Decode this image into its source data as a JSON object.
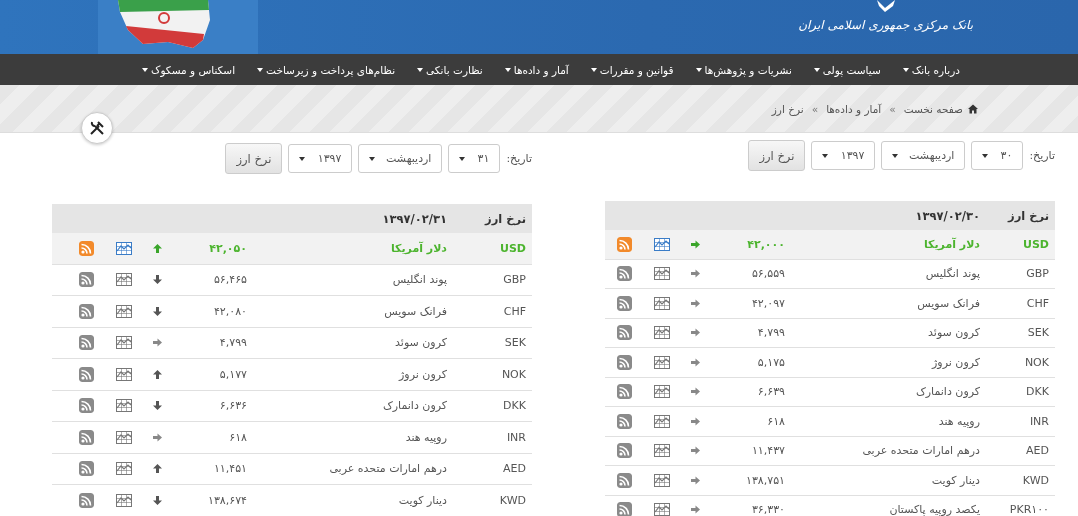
{
  "header": {
    "bank_name": "بانک مرکزی جمهوری اسلامی ایران"
  },
  "nav": [
    {
      "label": "درباره بانک"
    },
    {
      "label": "سیاست پولی"
    },
    {
      "label": "نشریات و پژوهش‌ها"
    },
    {
      "label": "قوانین و مقررات"
    },
    {
      "label": "آمار و داده‌ها"
    },
    {
      "label": "نظارت بانکی"
    },
    {
      "label": "نظام‌های پرداخت و زیرساخت"
    },
    {
      "label": "اسکناس و مسکوک"
    }
  ],
  "breadcrumb": [
    {
      "kind": "home",
      "label": "صفحه نخست"
    },
    {
      "kind": "separator",
      "label": "»"
    },
    {
      "kind": "link",
      "label": "آمار و داده‌ها"
    },
    {
      "kind": "separator",
      "label": "»"
    },
    {
      "kind": "current",
      "label": "نرخ ارز"
    }
  ],
  "panels": [
    {
      "date_label": "تاریخ:",
      "day": "۳۰",
      "month": "اردیبهشت",
      "year": "۱۳۹۷",
      "button": "نرخ ارز",
      "table": {
        "heading": "نرخ ارز",
        "date": "۱۳۹۷/۰۲/۳۰",
        "rows": [
          {
            "code": "USD",
            "name": "دلار آمریکا",
            "rate": "۴۲,۰۰۰",
            "rising": false,
            "falling": false,
            "highlighted": true
          },
          {
            "code": "GBP",
            "name": "پوند انگلیس",
            "rate": "۵۶,۵۵۹",
            "rising": false,
            "falling": false,
            "highlighted": false
          },
          {
            "code": "CHF",
            "name": "فرانک سویس",
            "rate": "۴۲,۰۹۷",
            "rising": false,
            "falling": false,
            "highlighted": false
          },
          {
            "code": "SEK",
            "name": "کرون سوئد",
            "rate": "۴,۷۹۹",
            "rising": false,
            "falling": false,
            "highlighted": false
          },
          {
            "code": "NOK",
            "name": "کرون نروژ",
            "rate": "۵,۱۷۵",
            "rising": false,
            "falling": false,
            "highlighted": false
          },
          {
            "code": "DKK",
            "name": "کرون دانمارک",
            "rate": "۶,۶۳۹",
            "rising": false,
            "falling": false,
            "highlighted": false
          },
          {
            "code": "INR",
            "name": "روپیه هند",
            "rate": "۶۱۸",
            "rising": false,
            "falling": false,
            "highlighted": false
          },
          {
            "code": "AED",
            "name": "درهم امارات متحده عربی",
            "rate": "۱۱,۴۳۷",
            "rising": false,
            "falling": false,
            "highlighted": false
          },
          {
            "code": "KWD",
            "name": "دینار کویت",
            "rate": "۱۳۸,۷۵۱",
            "rising": false,
            "falling": false,
            "highlighted": false
          },
          {
            "code": "PKR۱۰۰",
            "name": "یکصد روپیه پاکستان",
            "rate": "۳۶,۳۳۰",
            "rising": false,
            "falling": false,
            "highlighted": false
          }
        ]
      }
    },
    {
      "date_label": "تاریخ:",
      "day": "۳۱",
      "month": "اردیبهشت",
      "year": "۱۳۹۷",
      "button": "نرخ ارز",
      "table": {
        "heading": "نرخ ارز",
        "date": "۱۳۹۷/۰۲/۳۱",
        "rows": [
          {
            "code": "USD",
            "name": "دلار آمریکا",
            "rate": "۴۲,۰۵۰",
            "rising": true,
            "falling": false,
            "highlighted": true
          },
          {
            "code": "GBP",
            "name": "پوند انگلیس",
            "rate": "۵۶,۴۶۵",
            "rising": false,
            "falling": true,
            "highlighted": false
          },
          {
            "code": "CHF",
            "name": "فرانک سویس",
            "rate": "۴۲,۰۸۰",
            "rising": false,
            "falling": true,
            "highlighted": false
          },
          {
            "code": "SEK",
            "name": "کرون سوئد",
            "rate": "۴,۷۹۹",
            "rising": false,
            "falling": false,
            "highlighted": false
          },
          {
            "code": "NOK",
            "name": "کرون نروژ",
            "rate": "۵,۱۷۷",
            "rising": true,
            "falling": false,
            "highlighted": false
          },
          {
            "code": "DKK",
            "name": "کرون دانمارک",
            "rate": "۶,۶۳۶",
            "rising": false,
            "falling": true,
            "highlighted": false
          },
          {
            "code": "INR",
            "name": "روپیه هند",
            "rate": "۶۱۸",
            "rising": false,
            "falling": false,
            "highlighted": false
          },
          {
            "code": "AED",
            "name": "درهم امارات متحده عربی",
            "rate": "۱۱,۴۵۱",
            "rising": true,
            "falling": false,
            "highlighted": false
          },
          {
            "code": "KWD",
            "name": "دینار کویت",
            "rate": "۱۳۸,۶۷۴",
            "rising": false,
            "falling": true,
            "highlighted": false
          }
        ]
      }
    }
  ]
}
